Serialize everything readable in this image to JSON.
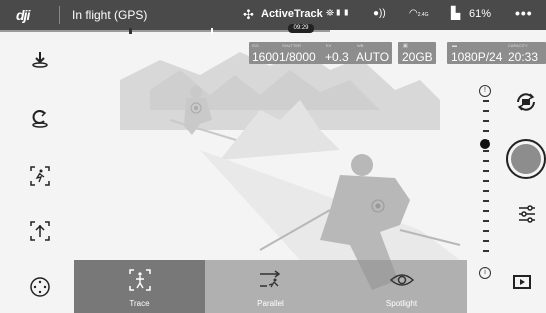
{
  "top_bar": {
    "logo": "dji",
    "flight_status": "In flight (GPS)",
    "flight_mode": "ActiveTrack",
    "battery": "61%",
    "more": "•••",
    "signal_rc": "2.4G"
  },
  "timeline": {
    "time": "09:29"
  },
  "camera": {
    "iso": {
      "label": "ISO",
      "value": "1600"
    },
    "shutter": {
      "label": "SHUTTER",
      "value": "1/8000"
    },
    "ev": {
      "label": "EV",
      "value": "+0.3"
    },
    "wb": {
      "label": "WB",
      "value": "AUTO"
    },
    "storage": {
      "value": "20GB"
    },
    "resolution": {
      "value": "1080P/24"
    },
    "capacity": {
      "label": "CAPACITY",
      "value": "20:33"
    }
  },
  "left_icons": [
    "takeoff-land-icon",
    "return-home-icon",
    "track-person-icon",
    "point-of-interest-icon",
    "more-modes-icon"
  ],
  "right_icons": [
    "switch-camera-icon",
    "shutter-button",
    "camera-settings-icon",
    "playback-icon"
  ],
  "modes": [
    {
      "label": "Trace",
      "icon": "trace-icon",
      "selected": true
    },
    {
      "label": "Parallel",
      "icon": "parallel-icon",
      "selected": false
    },
    {
      "label": "Spotlight",
      "icon": "spotlight-icon",
      "selected": false
    }
  ],
  "colors": {
    "topbar": "#4a4a4a",
    "modebar": "#969696",
    "selected_mode": "#6e6e6e"
  }
}
